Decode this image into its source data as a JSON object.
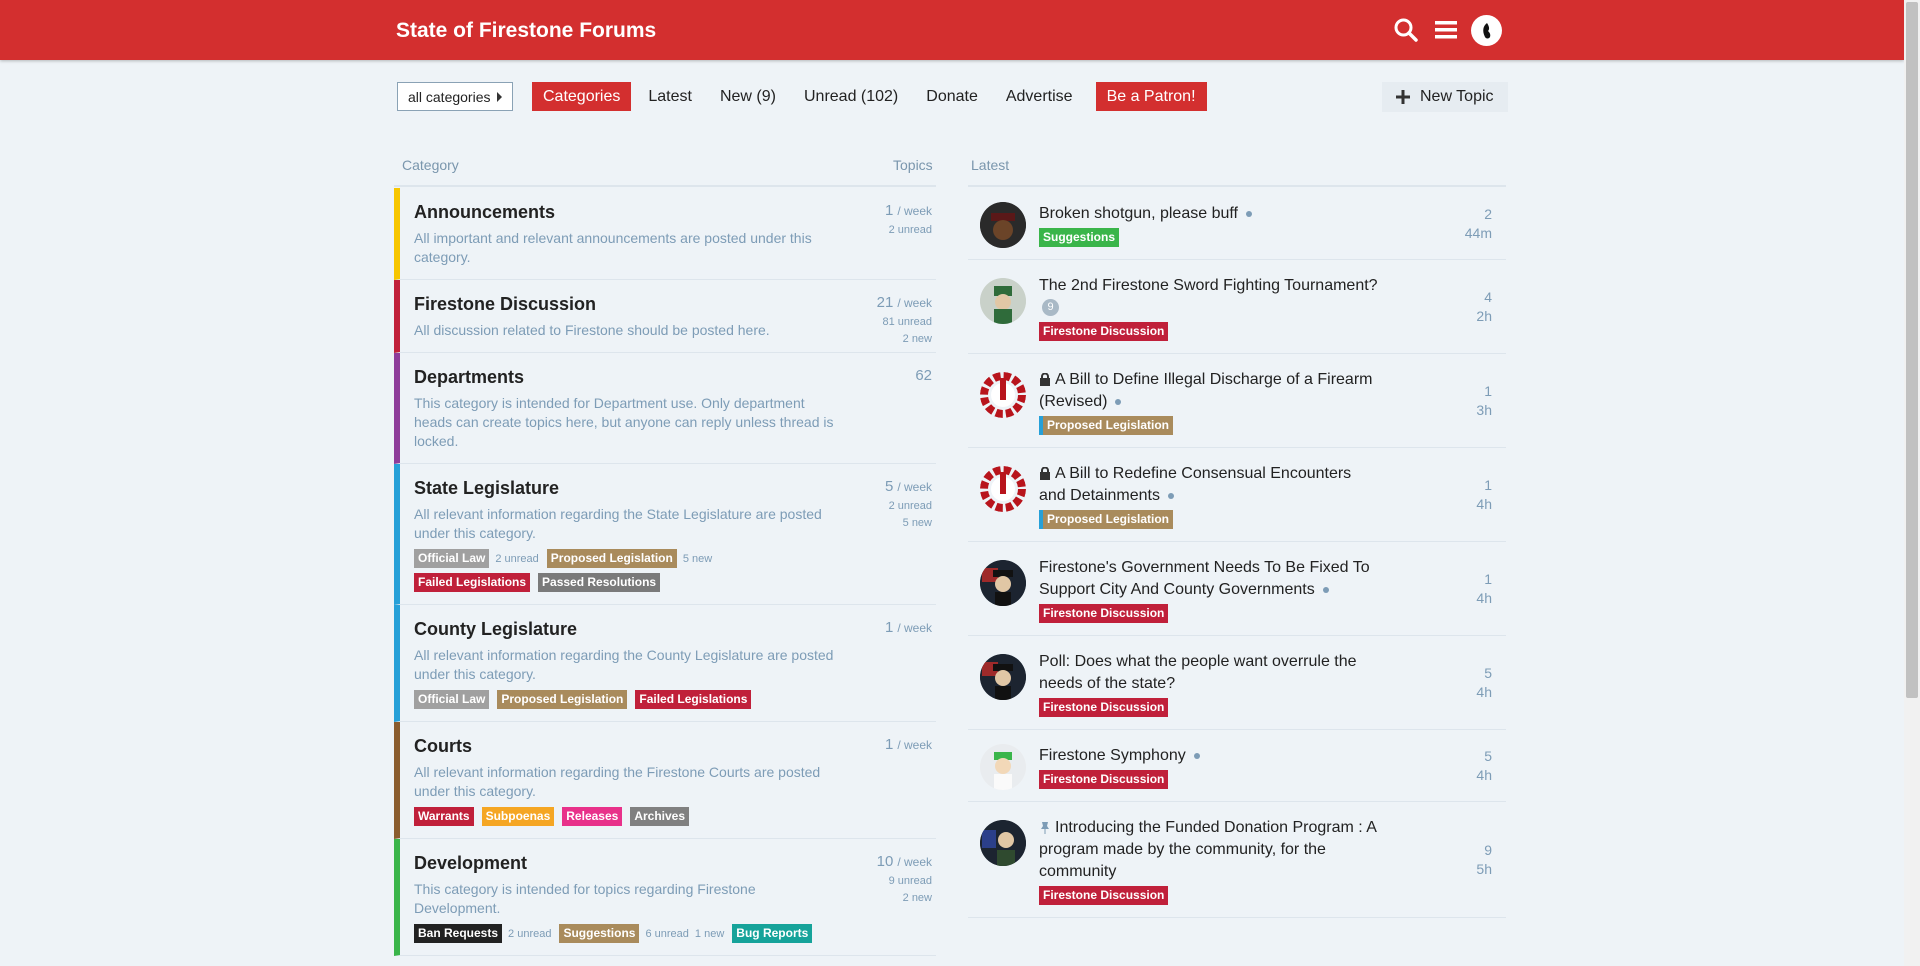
{
  "header": {
    "title": "State of Firestone Forums"
  },
  "nav": {
    "category_dropdown": "all categories",
    "items": [
      "Categories",
      "Latest",
      "New (9)",
      "Unread (102)",
      "Donate",
      "Advertise"
    ],
    "patron": "Be a Patron!",
    "new_topic": "New Topic"
  },
  "columns": {
    "category": "Category",
    "topics": "Topics",
    "latest": "Latest"
  },
  "colors": {
    "brand": "#d32f2f",
    "announcements": "#f7c600",
    "discussion": "#c0203a",
    "departments": "#8e3c9a",
    "state_leg": "#26a0d8",
    "county_leg": "#26a0d8",
    "courts": "#8a5c2e",
    "development": "#3ab54a",
    "official_law": "#a0a0a0",
    "proposed_legislation": "#a98b5c",
    "failed_legislations": "#c0203a",
    "passed_resolutions": "#7a7a7a",
    "warrants": "#c0203a",
    "subpoenas": "#f5a623",
    "releases": "#e8318a",
    "archives": "#808080",
    "ban_requests": "#222222",
    "suggestions_badge": "#a98b5c",
    "bug_reports": "#16a39a",
    "suggestions_latest": "#3ab54a",
    "proposed_latest": "#26a0d8"
  },
  "categories": [
    {
      "name": "Announcements",
      "desc": "All important and relevant announcements are posted under this category.",
      "count": "1",
      "period": "/ week",
      "unread": "2 unread",
      "new": ""
    },
    {
      "name": "Firestone Discussion",
      "desc": "All discussion related to Firestone should be posted here.",
      "count": "21",
      "period": "/ week",
      "unread": "81 unread",
      "new": "2 new"
    },
    {
      "name": "Departments",
      "desc": "This category is intended for Department use. Only department heads can create topics here, but anyone can reply unless thread is locked.",
      "count": "62",
      "period": "",
      "unread": "",
      "new": ""
    },
    {
      "name": "State Legislature",
      "desc": "All relevant information regarding the State Legislature are posted under this category.",
      "count": "5",
      "period": "/ week",
      "unread": "2 unread",
      "new": "5 new",
      "subs": [
        {
          "label": "Official Law",
          "note": "2 unread"
        },
        {
          "label": "Proposed Legislation",
          "note": "5 new"
        },
        {
          "label": "Failed Legislations",
          "note": ""
        },
        {
          "label": "Passed Resolutions",
          "note": ""
        }
      ]
    },
    {
      "name": "County Legislature",
      "desc": "All relevant information regarding the County Legislature are posted under this category.",
      "count": "1",
      "period": "/ week",
      "unread": "",
      "new": "",
      "subs": [
        {
          "label": "Official Law"
        },
        {
          "label": "Proposed Legislation"
        },
        {
          "label": "Failed Legislations"
        }
      ]
    },
    {
      "name": "Courts",
      "desc": "All relevant information regarding the Firestone Courts are posted under this category.",
      "count": "1",
      "period": "/ week",
      "unread": "",
      "new": "",
      "subs": [
        {
          "label": "Warrants"
        },
        {
          "label": "Subpoenas"
        },
        {
          "label": "Releases"
        },
        {
          "label": "Archives"
        }
      ]
    },
    {
      "name": "Development",
      "desc": "This category is intended for topics regarding Firestone Development.",
      "count": "10",
      "period": "/ week",
      "unread": "9 unread",
      "new": "2 new",
      "subs": [
        {
          "label": "Ban Requests",
          "note": "2 unread"
        },
        {
          "label": "Suggestions",
          "note": "6 unread",
          "note2": "1 new"
        },
        {
          "label": "Bug Reports"
        }
      ]
    }
  ],
  "latest": [
    {
      "title": "Broken shotgun, please buff",
      "category": "Suggestions",
      "replies": "2",
      "age": "44m",
      "icon": "avatar-dark-hat"
    },
    {
      "title": "The 2nd Firestone Sword Fighting Tournament?",
      "bubble": "9",
      "category": "Firestone Discussion",
      "replies": "4",
      "age": "2h",
      "icon": "avatar-green-hat"
    },
    {
      "title": "A Bill to Define Illegal Discharge of a Firearm (Revised)",
      "locked": true,
      "category": "Proposed Legislation",
      "replies": "1",
      "age": "3h",
      "icon": "red-gear-logo"
    },
    {
      "title": "A Bill to Redefine Consensual Encounters and Detainments",
      "locked": true,
      "category": "Proposed Legislation",
      "replies": "1",
      "age": "4h",
      "icon": "red-gear-logo"
    },
    {
      "title": "Firestone's Government Needs To Be Fixed To Support City And County Governments",
      "category": "Firestone Discussion",
      "replies": "1",
      "age": "4h",
      "icon": "avatar-flag-hat"
    },
    {
      "title": "Poll: Does what the people want overrule the needs of the state?",
      "category": "Firestone Discussion",
      "replies": "5",
      "age": "4h",
      "icon": "avatar-flag-hat"
    },
    {
      "title": "Firestone Symphony",
      "category": "Firestone Discussion",
      "replies": "5",
      "age": "4h",
      "icon": "avatar-green-hair"
    },
    {
      "title": "Introducing the Funded Donation Program : A program made by the community, for the community",
      "pinned": true,
      "category": "Firestone Discussion",
      "replies": "9",
      "age": "5h",
      "icon": "avatar-flag-suit"
    }
  ]
}
